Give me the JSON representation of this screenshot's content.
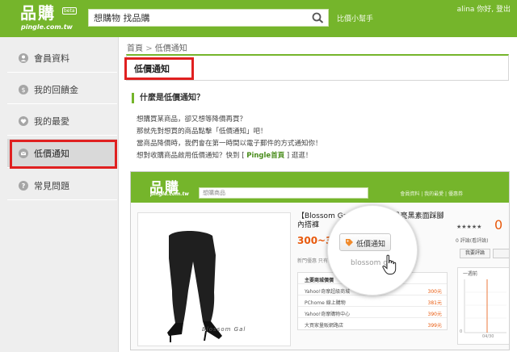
{
  "header": {
    "logo": "品購",
    "logo_badge": "beta",
    "logo_sub": "pingle.com.tw",
    "search_value": "想購物 找品購",
    "helper_link": "比價小幫手",
    "user_area": "alina 你好, 登出",
    "colors": {
      "brand_green": "#75b52b"
    }
  },
  "sidebar": {
    "items": [
      {
        "label": "會員資料",
        "icon": "person-icon"
      },
      {
        "label": "我的回饋金",
        "icon": "coin-icon"
      },
      {
        "label": "我的最愛",
        "icon": "heart-icon"
      },
      {
        "label": "低價通知",
        "icon": "mail-icon",
        "active": true
      },
      {
        "label": "常見問題",
        "icon": "question-icon"
      }
    ]
  },
  "breadcrumb": {
    "home": "首頁",
    "separator": ">",
    "current": "低價通知"
  },
  "page": {
    "title": "低價通知",
    "section_heading": "什麼是低價通知？",
    "desc": {
      "line1": "想購買某商品，卻又想等降價再買？",
      "line2": "那就先對想買的商品點擊「低價通知」吧！",
      "line3": "當商品降價時，我們會在第一時間以電子郵件的方式通知你！",
      "line4_pre": "想對收購商品啟用低價通知？快到 [ ",
      "line4_link": "Pingle首頁",
      "line4_post": " ] 逛逛！"
    }
  },
  "preview": {
    "logo": "品購",
    "logo_sub": "pingle.com.tw",
    "search_placeholder": "想購商品",
    "links": "會員資料 | 我的最愛 | 優惠券",
    "product_title_1": "【Blossom Gal】完美曲線黑晶亮黑素面踩腳",
    "product_title_2": "內搭褲",
    "price": "300~39",
    "tags": "新門優惠  只有  最低價  團購  拍賣  優惠  會員  特色  好品",
    "caption": "Blossom Gal",
    "table": {
      "header": "主要商城價價",
      "rows": [
        {
          "store": "Yahoo!奇摩超級商城",
          "price": "300元"
        },
        {
          "store": "PChome 線上購物",
          "price": "381元"
        },
        {
          "store": "Yahoo!奇摩購物中心",
          "price": "390元"
        },
        {
          "store": "大買家量販網路店",
          "price": "399元"
        }
      ]
    },
    "rating_stars": "★★★★★",
    "rating_value": "0",
    "rating_count": "0 評論(看評論)",
    "review_button": "我要評論",
    "chart_tab": "一週前",
    "chart_label_date": "04/30",
    "chart_label_val": "0",
    "magnifier_button": "低價通知",
    "magnifier_sub": "blossom g"
  }
}
